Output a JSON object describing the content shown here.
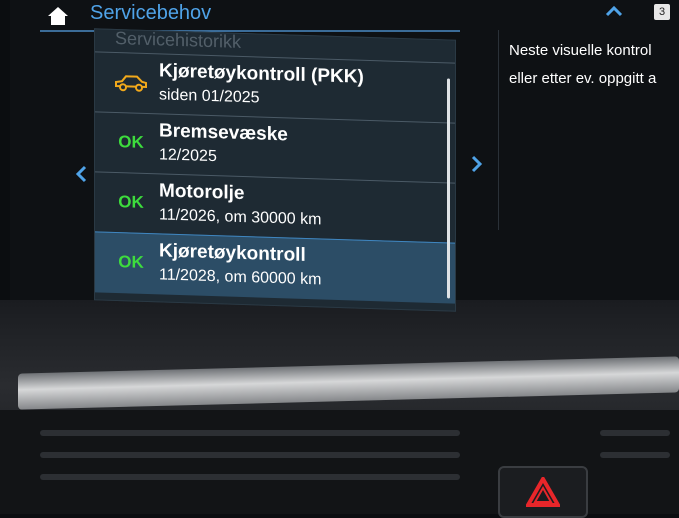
{
  "header": {
    "title": "Servicebehov",
    "home_icon": "home-icon",
    "scroll_icon": "chevron-up-icon",
    "page_badge": "3"
  },
  "list": {
    "previous_item_partial": "Servicehistorikk",
    "items": [
      {
        "status": "car-warning-icon",
        "status_text": "",
        "title": "Kjøretøykontroll (PKK)",
        "subtitle": "siden 01/2025",
        "selected": false
      },
      {
        "status": "ok",
        "status_text": "OK",
        "title": "Bremsevæske",
        "subtitle": "12/2025",
        "selected": false
      },
      {
        "status": "ok",
        "status_text": "OK",
        "title": "Motorolje",
        "subtitle": "11/2026, om 30000 km",
        "selected": false
      },
      {
        "status": "ok",
        "status_text": "OK",
        "title": "Kjøretøykontroll",
        "subtitle": "11/2028, om 60000 km",
        "selected": true
      }
    ]
  },
  "nav": {
    "left_icon": "chevron-left-icon",
    "right_icon": "chevron-right-icon"
  },
  "info": {
    "line1": "Neste visuelle kontrol",
    "line2": "eller etter ev. oppgitt a"
  },
  "colors": {
    "accent": "#4fa3e8",
    "ok_green": "#3ddc3d",
    "warning_amber": "#f2a91b",
    "selected_row": "#2c4d66"
  },
  "physical": {
    "hazard_icon": "hazard-warning-icon"
  }
}
